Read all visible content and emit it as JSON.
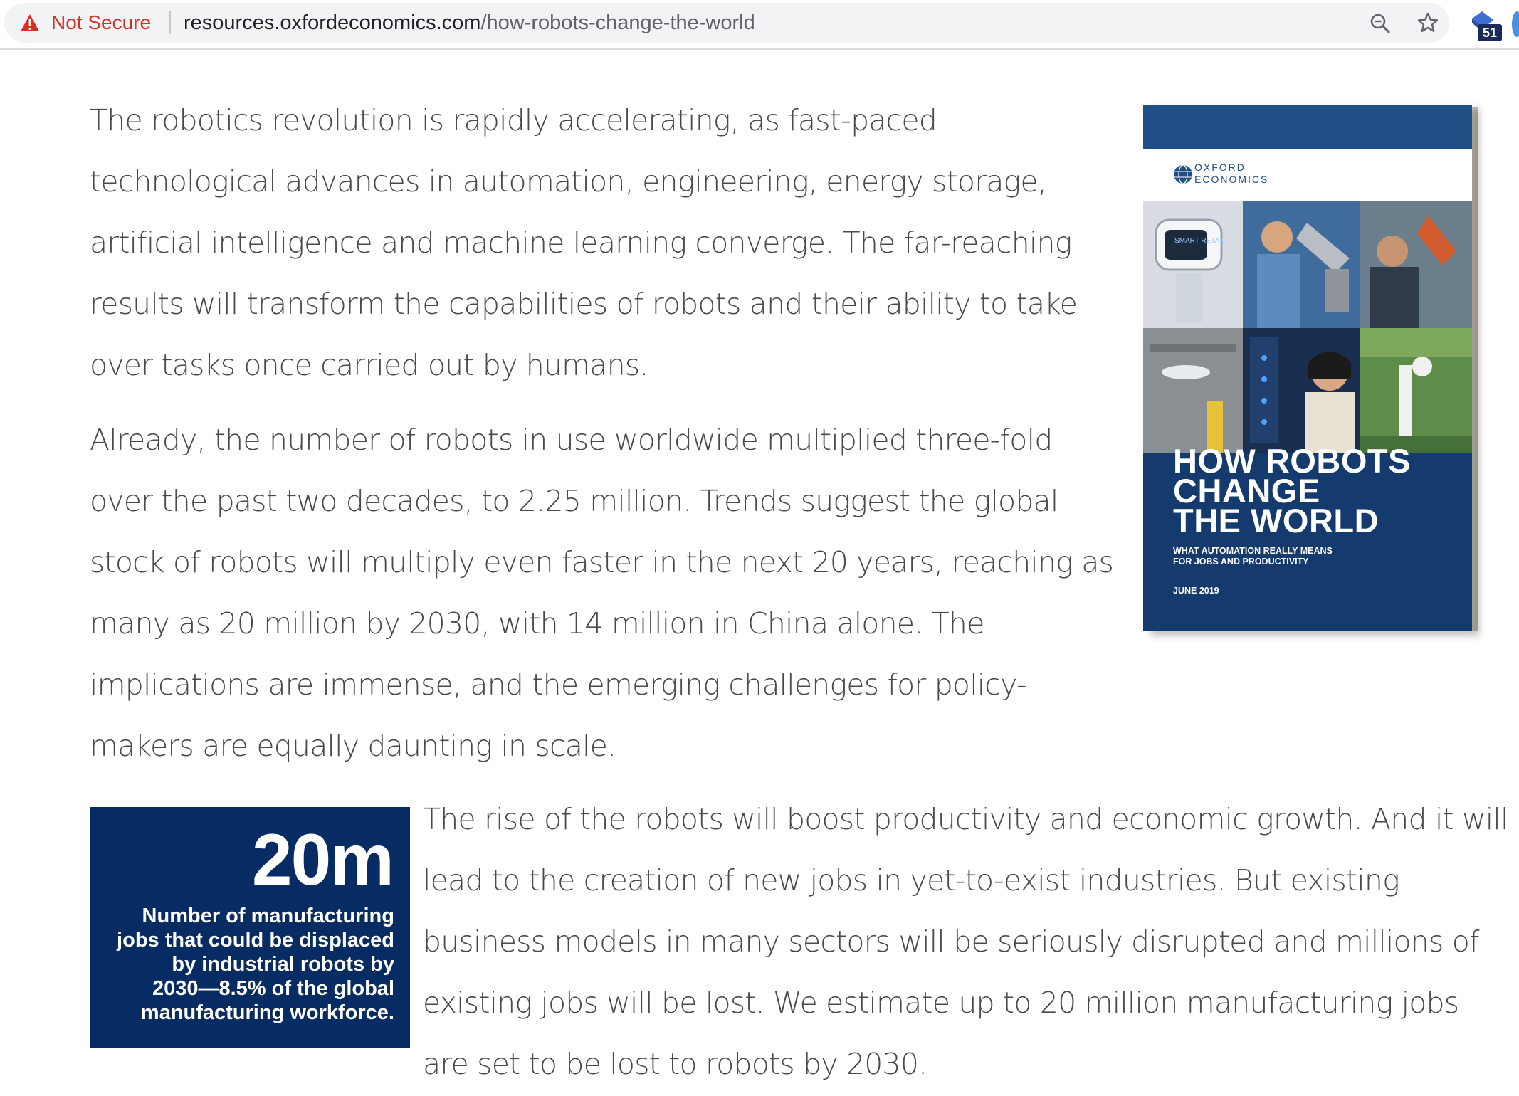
{
  "browser": {
    "security_label": "Not Secure",
    "url_host": "resources.oxfordeconomics.com",
    "url_path": "/how-robots-change-the-world",
    "extension_badge": "51"
  },
  "article": {
    "paragraph_1": "The robotics revolution is rapidly accelerating, as fast-paced technological advances in automation, engineering, energy storage, artificial intelligence and machine learning converge. The far-reaching results will transform the capabilities of robots and their ability to take over tasks once carried out by humans.",
    "paragraph_2": "Already, the number of robots in use worldwide multiplied three-fold over the past two decades, to 2.25 million. Trends suggest the global stock of robots will multiply even faster in the next 20 years, reaching as many as 20 million by 2030, with 14 million in China alone. The implications are immense, and the emerging challenges for policy-makers are equally daunting in scale.",
    "paragraph_3": "The rise of the robots will boost productivity and economic growth. And it will lead to the creation of new jobs in yet-to-exist industries. But existing business models in many sectors will be seriously disrupted and millions of existing jobs will be lost. We estimate up to 20 million manufacturing jobs are set to be lost to robots by 2030."
  },
  "cover": {
    "logo_line_1": "OXFORD",
    "logo_line_2": "ECONOMICS",
    "photo_label": "SMART RETAIL",
    "title_lines": [
      "HOW ROBOTS",
      "CHANGE",
      "THE WORLD"
    ],
    "subtitle_lines": [
      "WHAT AUTOMATION REALLY MEANS",
      "FOR JOBS AND PRODUCTIVITY"
    ],
    "date": "JUNE 2019"
  },
  "stat": {
    "value": "20m",
    "caption_lines": [
      "Number of manufacturing",
      "jobs that could be displaced",
      "by industrial robots by",
      "2030—8.5% of the global",
      "manufacturing workforce."
    ]
  },
  "colors": {
    "warning_red": "#d93025",
    "stat_navy": "#072c63",
    "cover_navy": "#143a6e"
  },
  "icons": {
    "security": "warning-triangle-icon",
    "zoom": "zoom-icon",
    "bookmark": "star-icon",
    "extension": "extension-icon"
  }
}
